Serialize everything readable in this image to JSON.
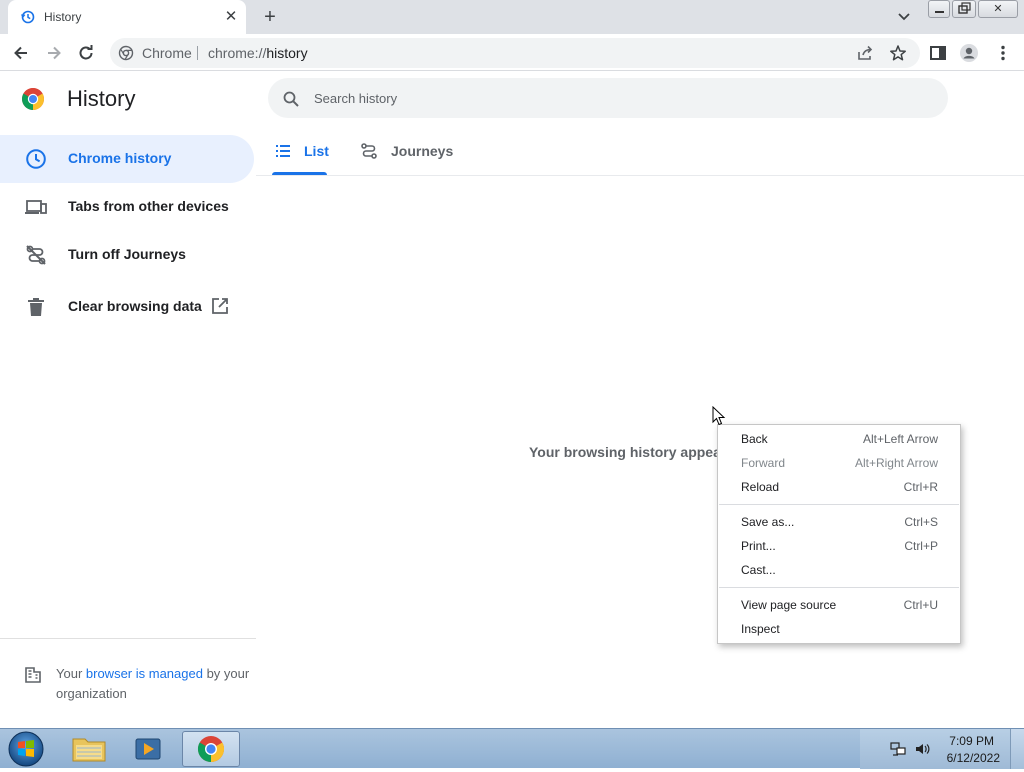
{
  "window": {
    "tab_title": "History",
    "tab_close": "✕",
    "new_tab": "+",
    "minimize": "—",
    "close": "✕"
  },
  "toolbar": {
    "omnibox_site": "Chrome",
    "url_prefix": "chrome://",
    "url_host": "history"
  },
  "page": {
    "title": "History",
    "search_placeholder": "Search history",
    "empty_message": "Your browsing history appears"
  },
  "sidebar": {
    "items": [
      {
        "label": "Chrome history",
        "icon": "clock-icon",
        "active": true
      },
      {
        "label": "Tabs from other devices",
        "icon": "devices-icon"
      },
      {
        "label": "Turn off Journeys",
        "icon": "journeys-off-icon"
      },
      {
        "label": "Clear browsing data",
        "icon": "trash-icon"
      }
    ],
    "managed": {
      "prefix": "Your ",
      "link": "browser is managed",
      "suffix": " by your organization"
    }
  },
  "main_tabs": [
    {
      "label": "List",
      "icon": "list-icon",
      "active": true
    },
    {
      "label": "Journeys",
      "icon": "journeys-icon"
    }
  ],
  "context_menu": {
    "groups": [
      [
        {
          "label": "Back",
          "shortcut": "Alt+Left Arrow"
        },
        {
          "label": "Forward",
          "shortcut": "Alt+Right Arrow",
          "disabled": true
        },
        {
          "label": "Reload",
          "shortcut": "Ctrl+R"
        }
      ],
      [
        {
          "label": "Save as...",
          "shortcut": "Ctrl+S"
        },
        {
          "label": "Print...",
          "shortcut": "Ctrl+P"
        },
        {
          "label": "Cast...",
          "shortcut": ""
        }
      ],
      [
        {
          "label": "View page source",
          "shortcut": "Ctrl+U"
        },
        {
          "label": "Inspect",
          "shortcut": ""
        }
      ]
    ]
  },
  "taskbar": {
    "time": "7:09 PM",
    "date": "6/12/2022"
  },
  "colors": {
    "accent": "#1a73e8",
    "active_bg": "#e8f0fe",
    "tabstrip": "#dee1e6"
  }
}
